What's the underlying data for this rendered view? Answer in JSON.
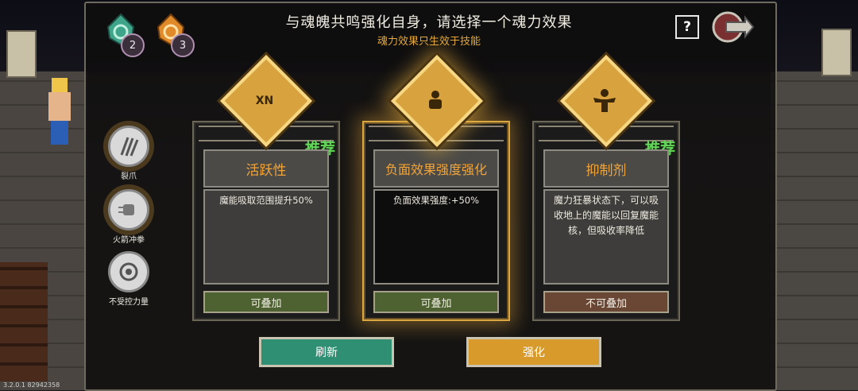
{
  "header": {
    "title": "与魂魄共鸣强化自身，请选择一个魂力效果",
    "subtitle": "魂力效果只生效于技能"
  },
  "resources": [
    {
      "name": "green-soul-gem-icon",
      "count": "2",
      "color": "#3fa58a"
    },
    {
      "name": "orange-soul-gem-icon",
      "count": "3",
      "color": "#e08a2a"
    }
  ],
  "skills": [
    {
      "label": "裂爪",
      "icon": "claw-slash-icon"
    },
    {
      "label": "火箭冲拳",
      "icon": "rocket-fist-icon"
    },
    {
      "label": "不受控力量",
      "icon": "uncontrolled-power-icon"
    }
  ],
  "cards": [
    {
      "name": "活跃性",
      "desc": "魔能吸取范围提升50%",
      "stack": "可叠加",
      "recommended": "推荐",
      "icon": "vortex-xn-emblem-icon"
    },
    {
      "name": "负面效果强度强化",
      "desc": "负面效果强度:+50%",
      "stack": "可叠加",
      "recommended": "",
      "icon": "crouching-figure-emblem-icon"
    },
    {
      "name": "抑制剂",
      "desc": "魔力狂暴状态下，可以吸收地上的魔能以回复魔能核，但吸收率降低",
      "stack": "不可叠加",
      "recommended": "推荐",
      "icon": "flexing-figure-emblem-icon"
    }
  ],
  "buttons": {
    "refresh": "刷新",
    "upgrade": "强化",
    "help": "?"
  },
  "version": "3.2.0.1 82942358",
  "colors": {
    "accent_gold": "#d9a640",
    "recommend_green": "#63d65a",
    "stackable": "#4d6131",
    "non_stackable": "#6a4634"
  }
}
